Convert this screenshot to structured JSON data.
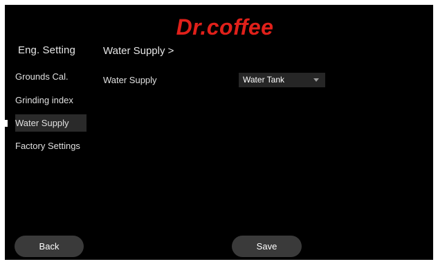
{
  "brand": {
    "logo_text": "Dr.coffee",
    "logo_color": "#e0201a"
  },
  "sidebar": {
    "title": "Eng. Setting",
    "items": [
      {
        "label": "Grounds Cal.",
        "selected": false
      },
      {
        "label": "Grinding index",
        "selected": false
      },
      {
        "label": "Water Supply",
        "selected": true
      },
      {
        "label": "Factory Settings",
        "selected": false
      }
    ]
  },
  "main": {
    "breadcrumb": "Water Supply >",
    "water_supply": {
      "label": "Water Supply",
      "selected_value": "Water Tank"
    }
  },
  "footer": {
    "back_label": "Back",
    "save_label": "Save"
  },
  "colors": {
    "background": "#000000",
    "selected_item_bg": "#2a2a2a",
    "button_bg": "#3a3a3a",
    "dropdown_bg": "#262626"
  }
}
